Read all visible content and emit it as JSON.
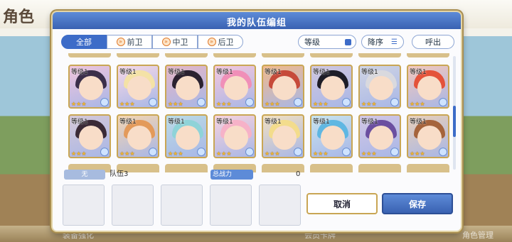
{
  "background": {
    "title": "角色",
    "bottom_labels": [
      "装备强化",
      "",
      "",
      "",
      "会员卡牌",
      "",
      "",
      "角色管理"
    ]
  },
  "dialog": {
    "title": "我的队伍编组",
    "filters": [
      {
        "label": "全部",
        "icon": ""
      },
      {
        "label": "前卫",
        "icon": "»"
      },
      {
        "label": "中卫",
        "icon": "»"
      },
      {
        "label": "后卫",
        "icon": "»"
      }
    ],
    "sort": {
      "label": "等级"
    },
    "order": {
      "label": "降序",
      "icon": "☰"
    },
    "call": {
      "label": "呼出"
    },
    "cards": [
      {
        "level": "等级1",
        "stars": "★★★",
        "hair": "#3b2f4a",
        "bg": "#f0c4dc"
      },
      {
        "level": "等级1",
        "stars": "★★★",
        "hair": "#f4e2a6",
        "bg": "#f6d8e6"
      },
      {
        "level": "等级1",
        "stars": "★★★",
        "hair": "#2b2230",
        "bg": "#e5b6c6"
      },
      {
        "level": "等级1",
        "stars": "★★★",
        "hair": "#f08fb8",
        "bg": "#f5c6dc"
      },
      {
        "level": "等级1",
        "stars": "★★★",
        "hair": "#c64a3a",
        "bg": "#f1b98a"
      },
      {
        "level": "等级1",
        "stars": "★★★",
        "hair": "#1d1d27",
        "bg": "#cfc6df"
      },
      {
        "level": "等级1",
        "stars": "★★★",
        "hair": "#d9d9de",
        "bg": "#cfd4e4"
      },
      {
        "level": "等级1",
        "stars": "★★★",
        "hair": "#e4533a",
        "bg": "#f3c7bb"
      },
      {
        "level": "等级1",
        "stars": "★★★",
        "hair": "#3a2a36",
        "bg": "#d5c8d8"
      },
      {
        "level": "等级1",
        "stars": "★★★",
        "hair": "#e39a5a",
        "bg": "#f4d5b0"
      },
      {
        "level": "等级1",
        "stars": "★★★",
        "hair": "#8fd3d8",
        "bg": "#b9dbe6"
      },
      {
        "level": "等级1",
        "stars": "★★★",
        "hair": "#f6b2c8",
        "bg": "#f7d2de"
      },
      {
        "level": "等级1",
        "stars": "★★★",
        "hair": "#f3dc8c",
        "bg": "#f2e0c0"
      },
      {
        "level": "等级1",
        "stars": "★★★",
        "hair": "#5fb7e2",
        "bg": "#c7e4ef"
      },
      {
        "level": "等级1",
        "stars": "★★★",
        "hair": "#6b4fa0",
        "bg": "#d2c6e6"
      },
      {
        "level": "等级1",
        "stars": "★★★",
        "hair": "#a5643c",
        "bg": "#e8cfb8"
      }
    ],
    "info": {
      "leader_label": "无",
      "team_name": "队伍3",
      "power_label": "总战力",
      "power_value": "0"
    },
    "buttons": {
      "cancel": "取消",
      "save": "保存"
    }
  }
}
